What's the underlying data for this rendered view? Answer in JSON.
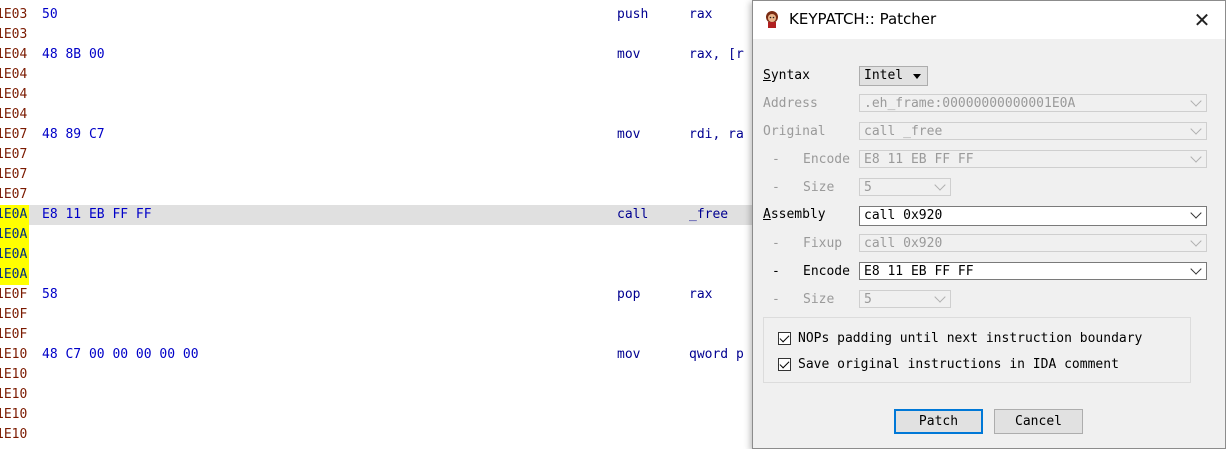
{
  "disasm": {
    "rows": [
      {
        "addr": "1E03",
        "bytes": "50",
        "mnemonic": "push",
        "operand": "rax",
        "yellow": false,
        "highlight": false
      },
      {
        "addr": "1E03",
        "bytes": "",
        "mnemonic": "",
        "operand": "",
        "yellow": false,
        "highlight": false
      },
      {
        "addr": "1E04",
        "bytes": "48 8B 00",
        "mnemonic": "mov",
        "operand": "rax, [r",
        "yellow": false,
        "highlight": false
      },
      {
        "addr": "1E04",
        "bytes": "",
        "mnemonic": "",
        "operand": "",
        "yellow": false,
        "highlight": false
      },
      {
        "addr": "1E04",
        "bytes": "",
        "mnemonic": "",
        "operand": "",
        "yellow": false,
        "highlight": false
      },
      {
        "addr": "1E04",
        "bytes": "",
        "mnemonic": "",
        "operand": "",
        "yellow": false,
        "highlight": false
      },
      {
        "addr": "1E07",
        "bytes": "48 89 C7",
        "mnemonic": "mov",
        "operand": "rdi, ra",
        "yellow": false,
        "highlight": false
      },
      {
        "addr": "1E07",
        "bytes": "",
        "mnemonic": "",
        "operand": "",
        "yellow": false,
        "highlight": false
      },
      {
        "addr": "1E07",
        "bytes": "",
        "mnemonic": "",
        "operand": "",
        "yellow": false,
        "highlight": false
      },
      {
        "addr": "1E07",
        "bytes": "",
        "mnemonic": "",
        "operand": "",
        "yellow": false,
        "highlight": false
      },
      {
        "addr": "1E0A",
        "bytes": "E8 11 EB FF FF",
        "mnemonic": "call",
        "operand": "_free",
        "yellow": true,
        "highlight": true
      },
      {
        "addr": "1E0A",
        "bytes": "",
        "mnemonic": "",
        "operand": "",
        "yellow": true,
        "highlight": false
      },
      {
        "addr": "1E0A",
        "bytes": "",
        "mnemonic": "",
        "operand": "",
        "yellow": true,
        "highlight": false
      },
      {
        "addr": "1E0A",
        "bytes": "",
        "mnemonic": "",
        "operand": "",
        "yellow": true,
        "highlight": false
      },
      {
        "addr": "1E0F",
        "bytes": "58",
        "mnemonic": "pop",
        "operand": "rax",
        "yellow": false,
        "highlight": false
      },
      {
        "addr": "1E0F",
        "bytes": "",
        "mnemonic": "",
        "operand": "",
        "yellow": false,
        "highlight": false
      },
      {
        "addr": "1E0F",
        "bytes": "",
        "mnemonic": "",
        "operand": "",
        "yellow": false,
        "highlight": false
      },
      {
        "addr": "1E10",
        "bytes": "48 C7 00 00 00 00 00",
        "mnemonic": "mov",
        "operand": "qword p",
        "yellow": false,
        "highlight": false
      },
      {
        "addr": "1E10",
        "bytes": "",
        "mnemonic": "",
        "operand": "",
        "yellow": false,
        "highlight": false
      },
      {
        "addr": "1E10",
        "bytes": "",
        "mnemonic": "",
        "operand": "",
        "yellow": false,
        "highlight": false
      },
      {
        "addr": "1E10",
        "bytes": "",
        "mnemonic": "",
        "operand": "",
        "yellow": false,
        "highlight": false
      },
      {
        "addr": "1E10",
        "bytes": "",
        "mnemonic": "",
        "operand": "",
        "yellow": false,
        "highlight": false
      }
    ]
  },
  "dialog": {
    "title": "KEYPATCH:: Patcher",
    "close_glyph": "✕",
    "syntax": {
      "label": "Syntax",
      "value": "Intel"
    },
    "address": {
      "label": "Address",
      "value": ".eh_frame:00000000000001E0A"
    },
    "original": {
      "label": "Original",
      "value": "call _free"
    },
    "original_encode": {
      "dash": "-",
      "label": "Encode",
      "value": "E8 11 EB FF FF"
    },
    "original_size": {
      "dash": "-",
      "label": "Size",
      "value": "5"
    },
    "assembly": {
      "label": "Assembly",
      "value": "call 0x920"
    },
    "fixup": {
      "dash": "-",
      "label": "Fixup",
      "value": "call 0x920"
    },
    "assembly_encode": {
      "dash": "-",
      "label": "Encode",
      "value": "E8 11 EB FF FF"
    },
    "assembly_size": {
      "dash": "-",
      "label": "Size",
      "value": "5"
    },
    "nops_option": {
      "label": "NOPs padding until next instruction boundary",
      "checked": true
    },
    "save_option": {
      "label": "Save original instructions in IDA comment",
      "checked": true
    },
    "patch_button": "Patch",
    "cancel_button": "Cancel"
  },
  "colors": {
    "address": "#7b1a00",
    "bytes": "#0000c8",
    "highlight": "#e0e0e0",
    "yellow": "#ffff00",
    "dialog_bg": "#f0f0f0",
    "default_button": "#0078d7"
  }
}
